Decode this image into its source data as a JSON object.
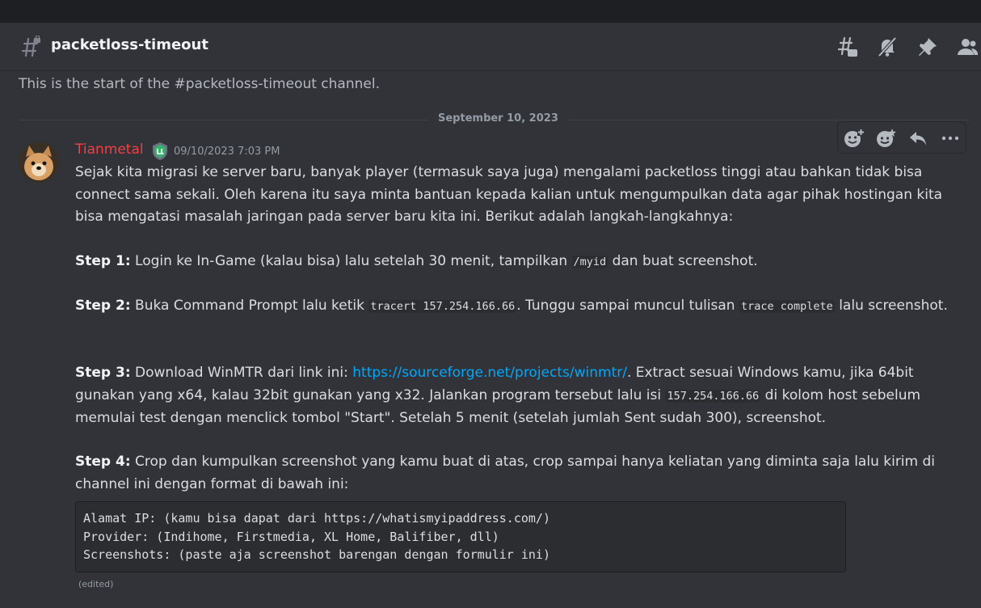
{
  "channel": {
    "name": "packetloss-timeout",
    "start_text": "This is the start of the #packetloss-timeout channel."
  },
  "header_icons": [
    "threads-icon",
    "notification-muted-icon",
    "pin-icon",
    "member-list-icon"
  ],
  "divider": {
    "date": "September 10, 2023"
  },
  "message": {
    "author": "Tianmetal",
    "author_color": "#f23f43",
    "timestamp": "09/10/2023 7:03 PM",
    "intro": "Sejak kita migrasi ke server baru, banyak player (termasuk saya juga) mengalami packetloss tinggi atau bahkan tidak bisa connect sama sekali. Oleh karena itu saya minta bantuan kepada kalian untuk mengumpulkan data agar pihak hostingan kita bisa mengatasi masalah jaringan pada server baru kita ini. Berikut adalah langkah-langkahnya:",
    "step1": {
      "label": "Step 1:",
      "text_a": " Login ke In-Game (kalau bisa) lalu setelah 30 menit, tampilkan ",
      "code": "/myid",
      "text_b": " dan buat screenshot."
    },
    "step2": {
      "label": "Step 2:",
      "text_a": " Buka Command Prompt lalu ketik ",
      "code_a": "tracert 157.254.166.66",
      "text_b": ". Tunggu sampai muncul tulisan ",
      "code_b": "trace complete",
      "text_c": " lalu screenshot."
    },
    "step3": {
      "label": "Step 3:",
      "text_a": " Download WinMTR dari link ini: ",
      "link": "https://sourceforge.net/projects/winmtr/",
      "text_b": ". Extract sesuai Windows kamu, jika 64bit gunakan yang x64, kalau 32bit gunakan yang x32. Jalankan program tersebut lalu isi ",
      "code": "157.254.166.66",
      "text_c": " di kolom host sebelum memulai test dengan menclick tombol \"Start\". Setelah 5 menit (setelah jumlah Sent sudah 300), screenshot."
    },
    "step4": {
      "label": "Step 4:",
      "text_a": " Crop dan kumpulkan screenshot yang kamu buat di atas, crop sampai hanya keliatan yang diminta saja lalu kirim di channel ini dengan format di bawah ini:"
    },
    "codeblock": "Alamat IP: (kamu bisa dapat dari https://whatismyipaddress.com/)\nProvider: (Indihome, Firstmedia, XL Home, Balifiber, dll)\nScreenshots: (paste aja screenshot barengan dengan formulir ini)",
    "edited": "(edited)"
  },
  "toolbar": [
    "add-reaction-icon",
    "super-reaction-icon",
    "reply-icon",
    "more-icon"
  ],
  "colors": {
    "background": "#313338",
    "link": "#00a8fc",
    "username": "#f23f43"
  }
}
